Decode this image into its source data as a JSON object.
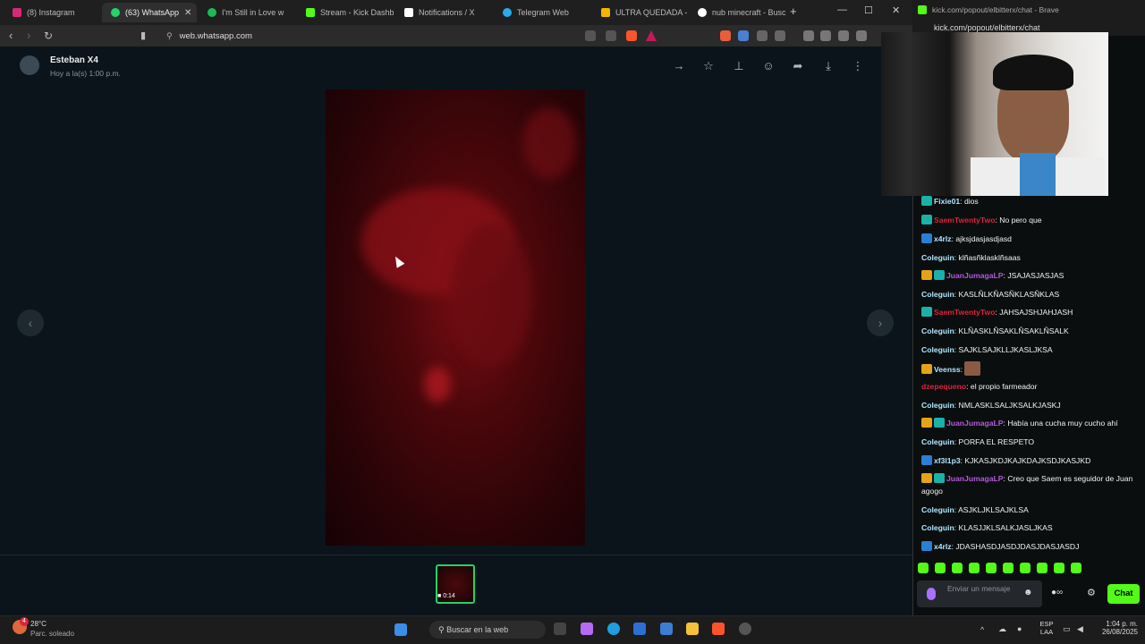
{
  "browser": {
    "tabs": [
      {
        "label": "(8) Instagram",
        "icon": "instagram-icon",
        "color": "#d62976"
      },
      {
        "label": "(63) WhatsApp",
        "icon": "whatsapp-icon",
        "color": "#25d366",
        "active": true
      },
      {
        "label": "I'm Still in Love w",
        "icon": "spotify-icon",
        "color": "#1db954"
      },
      {
        "label": "Stream - Kick Dashbo",
        "icon": "kick-icon",
        "color": "#53fc18"
      },
      {
        "label": "Notifications / X",
        "icon": "x-icon",
        "color": "#ffffff"
      },
      {
        "label": "Telegram Web",
        "icon": "telegram-icon",
        "color": "#2aabee"
      },
      {
        "label": "ULTRA QUEDADA - G",
        "icon": "drive-icon",
        "color": "#f4b400"
      },
      {
        "label": "nub minecraft - Busc",
        "icon": "google-icon",
        "color": "#ffffff"
      }
    ],
    "url": "web.whatsapp.com"
  },
  "viewer": {
    "contact_name": "Esteban X4",
    "time": "Hoy a la(s) 1:00 p.m.",
    "thumb_duration": "0:14"
  },
  "kick": {
    "window_title": "kick.com/popout/elbitterx/chat - Brave",
    "url": "kick.com/popout/elbitterx/chat",
    "messages": [
      {
        "user": "Fixie01",
        "color": "#aee6ff",
        "text": "dios",
        "badges": [
          "#1ab2a8"
        ]
      },
      {
        "user": "SaemTwentyTwo",
        "color": "#d9243b",
        "text": "No pero que",
        "badges": [
          "#1ab2a8"
        ]
      },
      {
        "user": "x4rlz",
        "color": "#aee6ff",
        "text": "ajksjdasjasdjasd",
        "badges": [
          "#2a7fd4"
        ]
      },
      {
        "user": "Coleguin",
        "color": "#aee6ff",
        "text": "klñasñklasklñsaas",
        "badges": []
      },
      {
        "user": "JuanJumagaLP",
        "color": "#b35ad9",
        "text": "JSAJASJASJAS",
        "badges": [
          "#e6a317",
          "#1ab2a8"
        ]
      },
      {
        "user": "Coleguin",
        "color": "#aee6ff",
        "text": "KASLÑLKÑASÑKLASÑKLAS",
        "badges": []
      },
      {
        "user": "SaemTwentyTwo",
        "color": "#d9243b",
        "text": "JAHSAJSHJAHJASH",
        "badges": [
          "#1ab2a8"
        ]
      },
      {
        "user": "Coleguin",
        "color": "#aee6ff",
        "text": "KLÑASKLÑSAKLÑSAKLÑSALK",
        "badges": []
      },
      {
        "user": "Coleguin",
        "color": "#aee6ff",
        "text": "SAJKLSAJKLLJKASLJKSA",
        "badges": []
      },
      {
        "user": "Veenss",
        "color": "#aee6ff",
        "text": "",
        "badges": [
          "#e6a317"
        ]
      },
      {
        "user": "dzepequeno",
        "color": "#d9243b",
        "text": "el propio farmeador",
        "badges": []
      },
      {
        "user": "Coleguin",
        "color": "#aee6ff",
        "text": "NMLASKLSALJKSALKJASKJ",
        "badges": []
      },
      {
        "user": "JuanJumagaLP",
        "color": "#b35ad9",
        "text": "Había una cucha muy cucho ahí",
        "badges": [
          "#e6a317",
          "#1ab2a8"
        ]
      },
      {
        "user": "Coleguin",
        "color": "#aee6ff",
        "text": "PORFA EL RESPETO",
        "badges": []
      },
      {
        "user": "xf3l1p3",
        "color": "#aee6ff",
        "text": "KJKASJKDJKAJKDAJKSDJKASJKD",
        "badges": [
          "#2a7fd4"
        ]
      },
      {
        "user": "JuanJumagaLP",
        "color": "#b35ad9",
        "text": "Creo que Saem es seguidor de Juan agogo",
        "badges": [
          "#e6a317",
          "#1ab2a8"
        ]
      },
      {
        "user": "Coleguin",
        "color": "#aee6ff",
        "text": "ASJKLJKLSAJKLSA",
        "badges": []
      },
      {
        "user": "Coleguin",
        "color": "#aee6ff",
        "text": "KLASJJKLSALKJASLJKAS",
        "badges": []
      },
      {
        "user": "x4rlz",
        "color": "#aee6ff",
        "text": "JDASHASDJASDJDASJDASJASDJ",
        "badges": [
          "#2a7fd4"
        ]
      }
    ],
    "input_placeholder": "Enviar un mensaje",
    "chat_button": "Chat"
  },
  "taskbar": {
    "temperature": "28°C",
    "weather": "Parc. soleado",
    "search_placeholder": "Buscar en la web",
    "lang_line1": "ESP",
    "lang_line2": "LAA",
    "time": "1:04 p. m.",
    "date": "26/08/2025",
    "notification_count": "4"
  }
}
